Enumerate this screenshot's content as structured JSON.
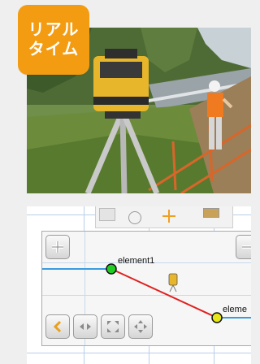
{
  "badge": {
    "line1": "リアル",
    "line2": "タイム",
    "color": "#f39c12"
  },
  "photo": {
    "description_icon": "surveyor-laser-photo"
  },
  "canvas": {
    "elements": [
      {
        "label": "element1",
        "color": "#22cc22"
      },
      {
        "label": "eleme",
        "color": "#e6e61a"
      }
    ],
    "line_color": "#e02020",
    "blue_line_color": "#3a9be0"
  },
  "toolbar": {
    "icons": [
      "rect-icon",
      "circle-icon",
      "plus-icon",
      "tag-icon"
    ],
    "bottom_buttons": [
      "back-arrow-icon",
      "collapse-icon",
      "fit-icon",
      "move-icon"
    ]
  }
}
